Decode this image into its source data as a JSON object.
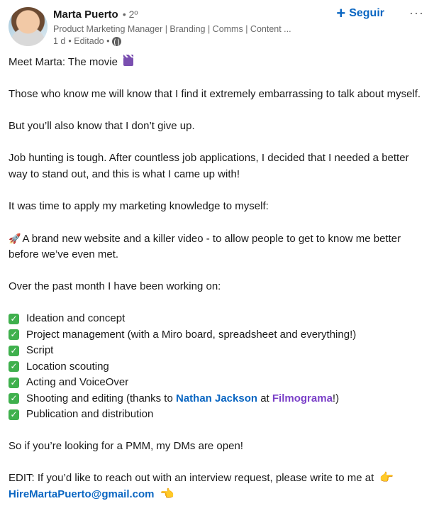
{
  "author": {
    "name": "Marta Puerto",
    "degree": "• 2º",
    "headline": "Product Marketing Manager | Branding | Comms | Content ...",
    "time": "1 d",
    "edited": "• Editado •"
  },
  "actions": {
    "follow_label": "Seguir",
    "more_label": "···"
  },
  "icons": {
    "avatar": "profile-photo",
    "globe": "globe-icon",
    "plus": "plus-icon",
    "clapper": "clapper-board-icon",
    "rocket": "rocket-icon",
    "check": "check-mark-icon",
    "pointing": "pointing-hand-icon"
  },
  "colors": {
    "accent": "#0a66c2",
    "company": "#7a3fc8",
    "check": "#3fb04d"
  },
  "post": {
    "title": "Meet Marta: The movie",
    "p1": "Those who know me will know that I find it extremely embarrassing to talk about myself.",
    "p2": "But you’ll also know that I don’t give up.",
    "p3": "Job hunting is tough. After countless job applications, I decided that I needed a better way to stand out, and this is what I came up with!",
    "p4": "It was time to apply my marketing knowledge to myself:",
    "p5": "A brand new website and a killer video - to allow people to get to know me better before we’ve even met.",
    "p6": "Over the past month I have been working on:",
    "checklist": [
      "Ideation and concept",
      "Project management (with a Miro board, spreadsheet and everything!)",
      "Script",
      "Location scouting",
      "Acting and VoiceOver"
    ],
    "shooting_prefix": "Shooting and editing (thanks to ",
    "shooting_mention": "Nathan Jackson",
    "shooting_at": " at ",
    "shooting_company": "Filmograma",
    "shooting_suffix": "!)",
    "last_check": "Publication and distribution",
    "p7": "So if you’re looking for a PMM, my DMs are open!",
    "edit_text": "EDIT: If you’d like to reach out with an interview request, please write to me at",
    "email": "HireMartaPuerto@gmail.com"
  }
}
